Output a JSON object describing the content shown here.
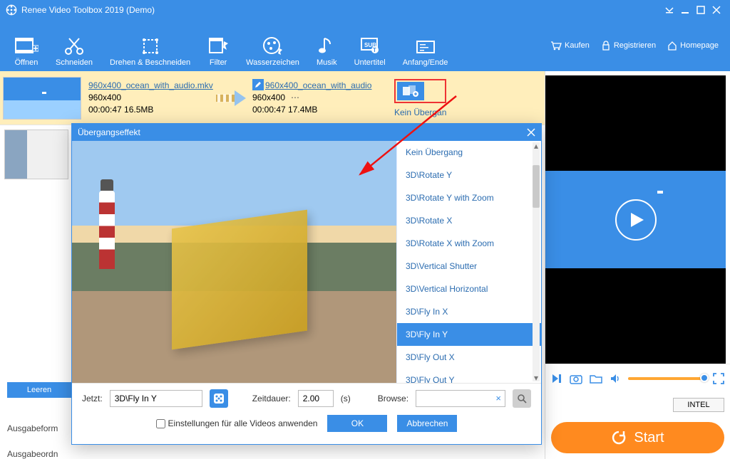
{
  "title": "Renee Video Toolbox 2019 (Demo)",
  "toolbar": {
    "open": "Öffnen",
    "cut": "Schneiden",
    "rotate": "Drehen & Beschneiden",
    "filter": "Filter",
    "watermark": "Wasserzeichen",
    "music": "Musik",
    "subtitle": "Untertitel",
    "trim": "Anfang/Ende",
    "buy": "Kaufen",
    "register": "Registrieren",
    "homepage": "Homepage"
  },
  "file": {
    "in_name": "960x400_ocean_with_audio.mkv",
    "in_res": "960x400",
    "in_dur_size": "00:00:47  16.5MB",
    "out_name": "960x400_ocean_with_audio",
    "out_res": "960x400",
    "out_dur_size": "00:00:47  17.4MB",
    "no_transition": "Kein Übergan"
  },
  "left_panel": {
    "clear": "Leeren",
    "format": "Ausgabeform",
    "folder": "Ausgabeordn"
  },
  "right_panel": {
    "chip": "INTEL",
    "start": "Start"
  },
  "dialog": {
    "title": "Übergangseffekt",
    "items": [
      "Kein Übergang",
      "3D\\Rotate Y",
      "3D\\Rotate Y with Zoom",
      "3D\\Rotate X",
      "3D\\Rotate X with Zoom",
      "3D\\Vertical Shutter",
      "3D\\Vertical Horizontal",
      "3D\\Fly In X",
      "3D\\Fly In Y",
      "3D\\Fly Out X",
      "3D\\Fly Out Y"
    ],
    "selected_index": 8,
    "now_label": "Jetzt:",
    "now_value": "3D\\Fly In Y",
    "duration_label": "Zeitdauer:",
    "duration_value": "2.00",
    "duration_unit": "(s)",
    "browse_label": "Browse:",
    "apply_all": "Einstellungen für alle Videos anwenden",
    "ok": "OK",
    "cancel": "Abbrechen"
  }
}
